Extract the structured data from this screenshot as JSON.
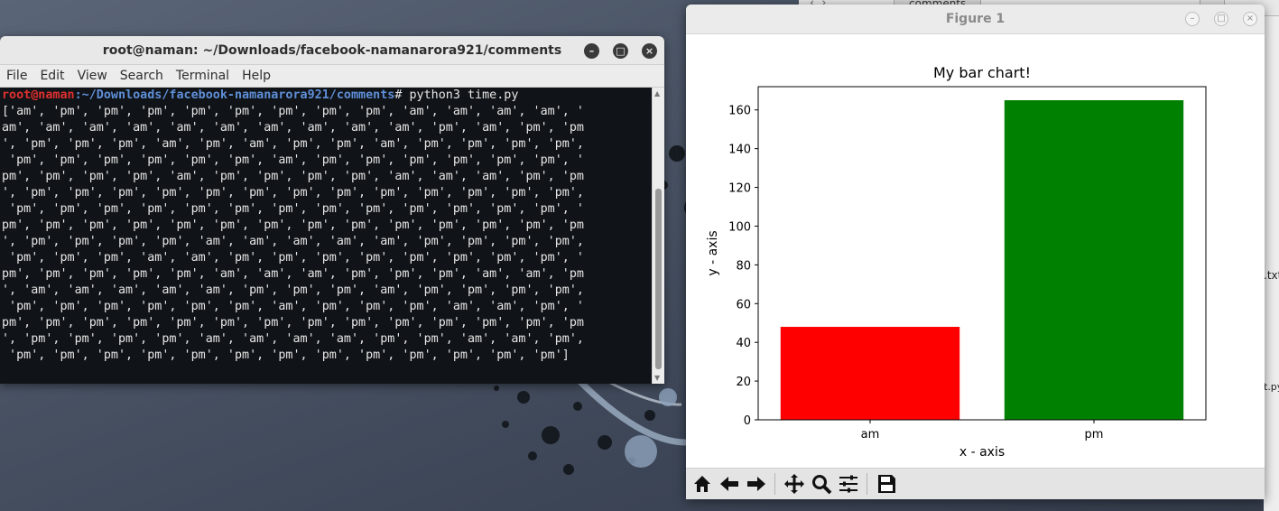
{
  "terminal": {
    "title": "root@naman: ~/Downloads/facebook-namanarora921/comments",
    "menu": [
      "File",
      "Edit",
      "View",
      "Search",
      "Terminal",
      "Help"
    ],
    "prompt_user": "root@naman",
    "prompt_path": ":~/Downloads/facebook-namanarora921/comments",
    "command": "# python3 time.py",
    "output_lines": [
      "['am', 'pm', 'pm', 'pm', 'pm', 'pm', 'pm', 'pm', 'pm', 'am', 'am', 'am', 'am', '",
      "am', 'am', 'am', 'am', 'am', 'am', 'am', 'am', 'am', 'am', 'pm', 'am', 'pm', 'pm",
      "', 'pm', 'pm', 'pm', 'am', 'pm', 'am', 'pm', 'pm', 'am', 'pm', 'pm', 'pm', 'pm',",
      " 'pm', 'pm', 'pm', 'pm', 'pm', 'pm', 'am', 'pm', 'pm', 'pm', 'pm', 'pm', 'pm', '",
      "pm', 'pm', 'pm', 'pm', 'am', 'pm', 'pm', 'pm', 'pm', 'am', 'am', 'am', 'pm', 'pm",
      "', 'pm', 'pm', 'pm', 'pm', 'pm', 'pm', 'pm', 'pm', 'pm', 'pm', 'pm', 'pm', 'pm',",
      " 'pm', 'pm', 'pm', 'pm', 'pm', 'pm', 'pm', 'pm', 'pm', 'pm', 'pm', 'pm', 'pm', '",
      "pm', 'pm', 'pm', 'pm', 'pm', 'pm', 'pm', 'pm', 'pm', 'pm', 'pm', 'pm', 'pm', 'pm",
      "', 'pm', 'pm', 'pm', 'pm', 'am', 'am', 'am', 'am', 'am', 'pm', 'pm', 'pm', 'pm',",
      " 'pm', 'pm', 'pm', 'am', 'am', 'pm', 'pm', 'pm', 'pm', 'pm', 'pm', 'pm', 'pm', '",
      "pm', 'pm', 'pm', 'pm', 'pm', 'am', 'am', 'am', 'pm', 'pm', 'pm', 'am', 'am', 'pm",
      "', 'am', 'am', 'am', 'am', 'am', 'pm', 'pm', 'pm', 'am', 'pm', 'pm', 'pm', 'pm',",
      " 'pm', 'pm', 'pm', 'pm', 'pm', 'pm', 'am', 'pm', 'pm', 'pm', 'am', 'am', 'pm', '",
      "pm', 'pm', 'pm', 'pm', 'pm', 'pm', 'pm', 'pm', 'pm', 'pm', 'pm', 'pm', 'pm', 'pm",
      "', 'pm', 'pm', 'pm', 'pm', 'am', 'am', 'am', 'am', 'pm', 'pm', 'am', 'am', 'pm',",
      " 'pm', 'pm', 'pm', 'pm', 'pm', 'pm', 'pm', 'pm', 'pm', 'pm', 'pm', 'pm', 'pm']"
    ]
  },
  "background": {
    "tab_label": "comments",
    "file_label_1": ".txt",
    "file_label_2": "t.py"
  },
  "figure": {
    "window_title": "Figure 1",
    "toolbar_icons": [
      "home-icon",
      "back-icon",
      "forward-icon",
      "pan-icon",
      "zoom-icon",
      "configure-subplots-icon",
      "save-icon"
    ]
  },
  "chart_data": {
    "type": "bar",
    "title": "My bar chart!",
    "xlabel": "x - axis",
    "ylabel": "y - axis",
    "categories": [
      "am",
      "pm"
    ],
    "values": [
      48,
      165
    ],
    "colors": [
      "#ff0000",
      "#008000"
    ],
    "ylim": [
      0,
      172
    ],
    "yticks": [
      0,
      20,
      40,
      60,
      80,
      100,
      120,
      140,
      160
    ],
    "grid": false
  }
}
